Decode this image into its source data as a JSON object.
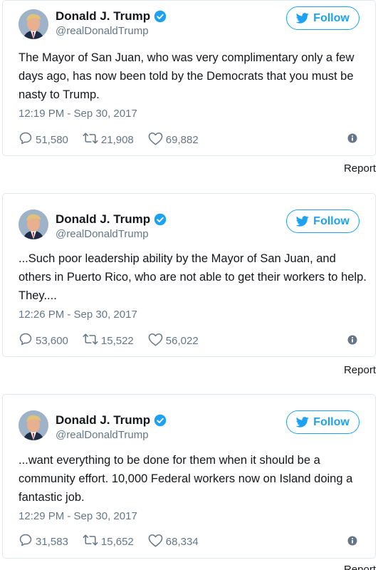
{
  "tweets": [
    {
      "name": "Donald J. Trump",
      "handle": "@realDonaldTrump",
      "follow_label": "Follow",
      "text": "The Mayor of San Juan, who was very complimentary only a few days ago, has now been told by the Democrats that you must be nasty to Trump.",
      "time": "12:19 PM - Sep 30, 2017",
      "replies": "51,580",
      "retweets": "21,908",
      "likes": "69,882",
      "report_label": "Report"
    },
    {
      "name": "Donald J. Trump",
      "handle": "@realDonaldTrump",
      "follow_label": "Follow",
      "text": "...Such poor leadership ability by the Mayor of San Juan, and others in Puerto Rico, who are not able to get their workers to help. They....",
      "time": "12:26 PM - Sep 30, 2017",
      "replies": "53,600",
      "retweets": "15,522",
      "likes": "56,022",
      "report_label": "Report"
    },
    {
      "name": "Donald J. Trump",
      "handle": "@realDonaldTrump",
      "follow_label": "Follow",
      "text": "...want everything to be done for them when it should be a community effort. 10,000 Federal workers now on Island doing a fantastic job.",
      "time": "12:29 PM - Sep 30, 2017",
      "replies": "31,583",
      "retweets": "15,652",
      "likes": "68,334",
      "report_label": "Report"
    }
  ],
  "icons": {
    "verified": "verified-badge-icon",
    "bird": "twitter-bird-icon",
    "reply": "reply-bubble-icon",
    "retweet": "retweet-icon",
    "like": "heart-icon",
    "info": "info-icon"
  },
  "colors": {
    "accent": "#1da1f2",
    "secondary_text": "#657786",
    "border": "#e1e8ed"
  }
}
